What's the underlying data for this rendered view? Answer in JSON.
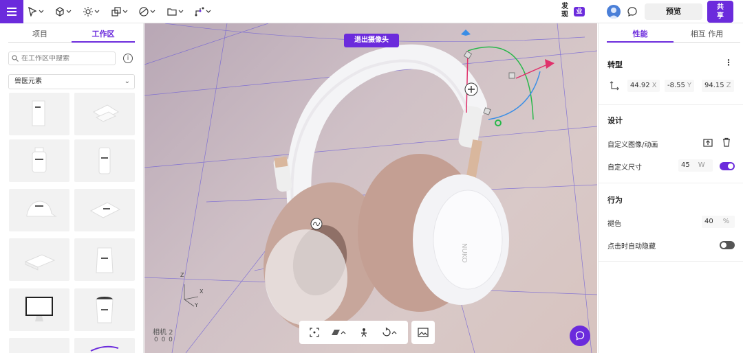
{
  "topbar": {
    "discover_label": "发现",
    "discover_badge": "业",
    "preview_label": "预览",
    "share_label": "共享"
  },
  "left_panel": {
    "tabs": [
      {
        "label": "项目"
      },
      {
        "label": "工作区"
      }
    ],
    "search_placeholder": "在工作区中搜索",
    "filter_selected": "兽医元素"
  },
  "viewport": {
    "exit_camera_label": "退出摄像头",
    "camera_name": "相机 2",
    "camera_stats": "0 0 0",
    "axis_labels": {
      "z": "Z",
      "x": "X",
      "y": "Y"
    },
    "product_text": "NUKO"
  },
  "right_panel": {
    "tabs": [
      {
        "label": "性能"
      },
      {
        "label": "相互 作用"
      }
    ],
    "transform": {
      "title": "转型",
      "x_value": "44.92",
      "x_axis": "X",
      "y_value": "-8.55",
      "y_axis": "Y",
      "z_value": "94.15",
      "z_axis": "Z"
    },
    "design": {
      "title": "设计",
      "custom_image_label": "自定义图像/动画",
      "custom_size_label": "自定义尺寸",
      "size_value": "45",
      "size_unit": "W",
      "size_toggle_on": true
    },
    "behavior": {
      "title": "行为",
      "fade_label": "褪色",
      "fade_value": "40",
      "fade_unit": "%",
      "autohide_label": "点击时自动隐藏",
      "autohide_on": false
    }
  },
  "colors": {
    "accent": "#6b2bdc",
    "toggle_off": "#555555"
  }
}
